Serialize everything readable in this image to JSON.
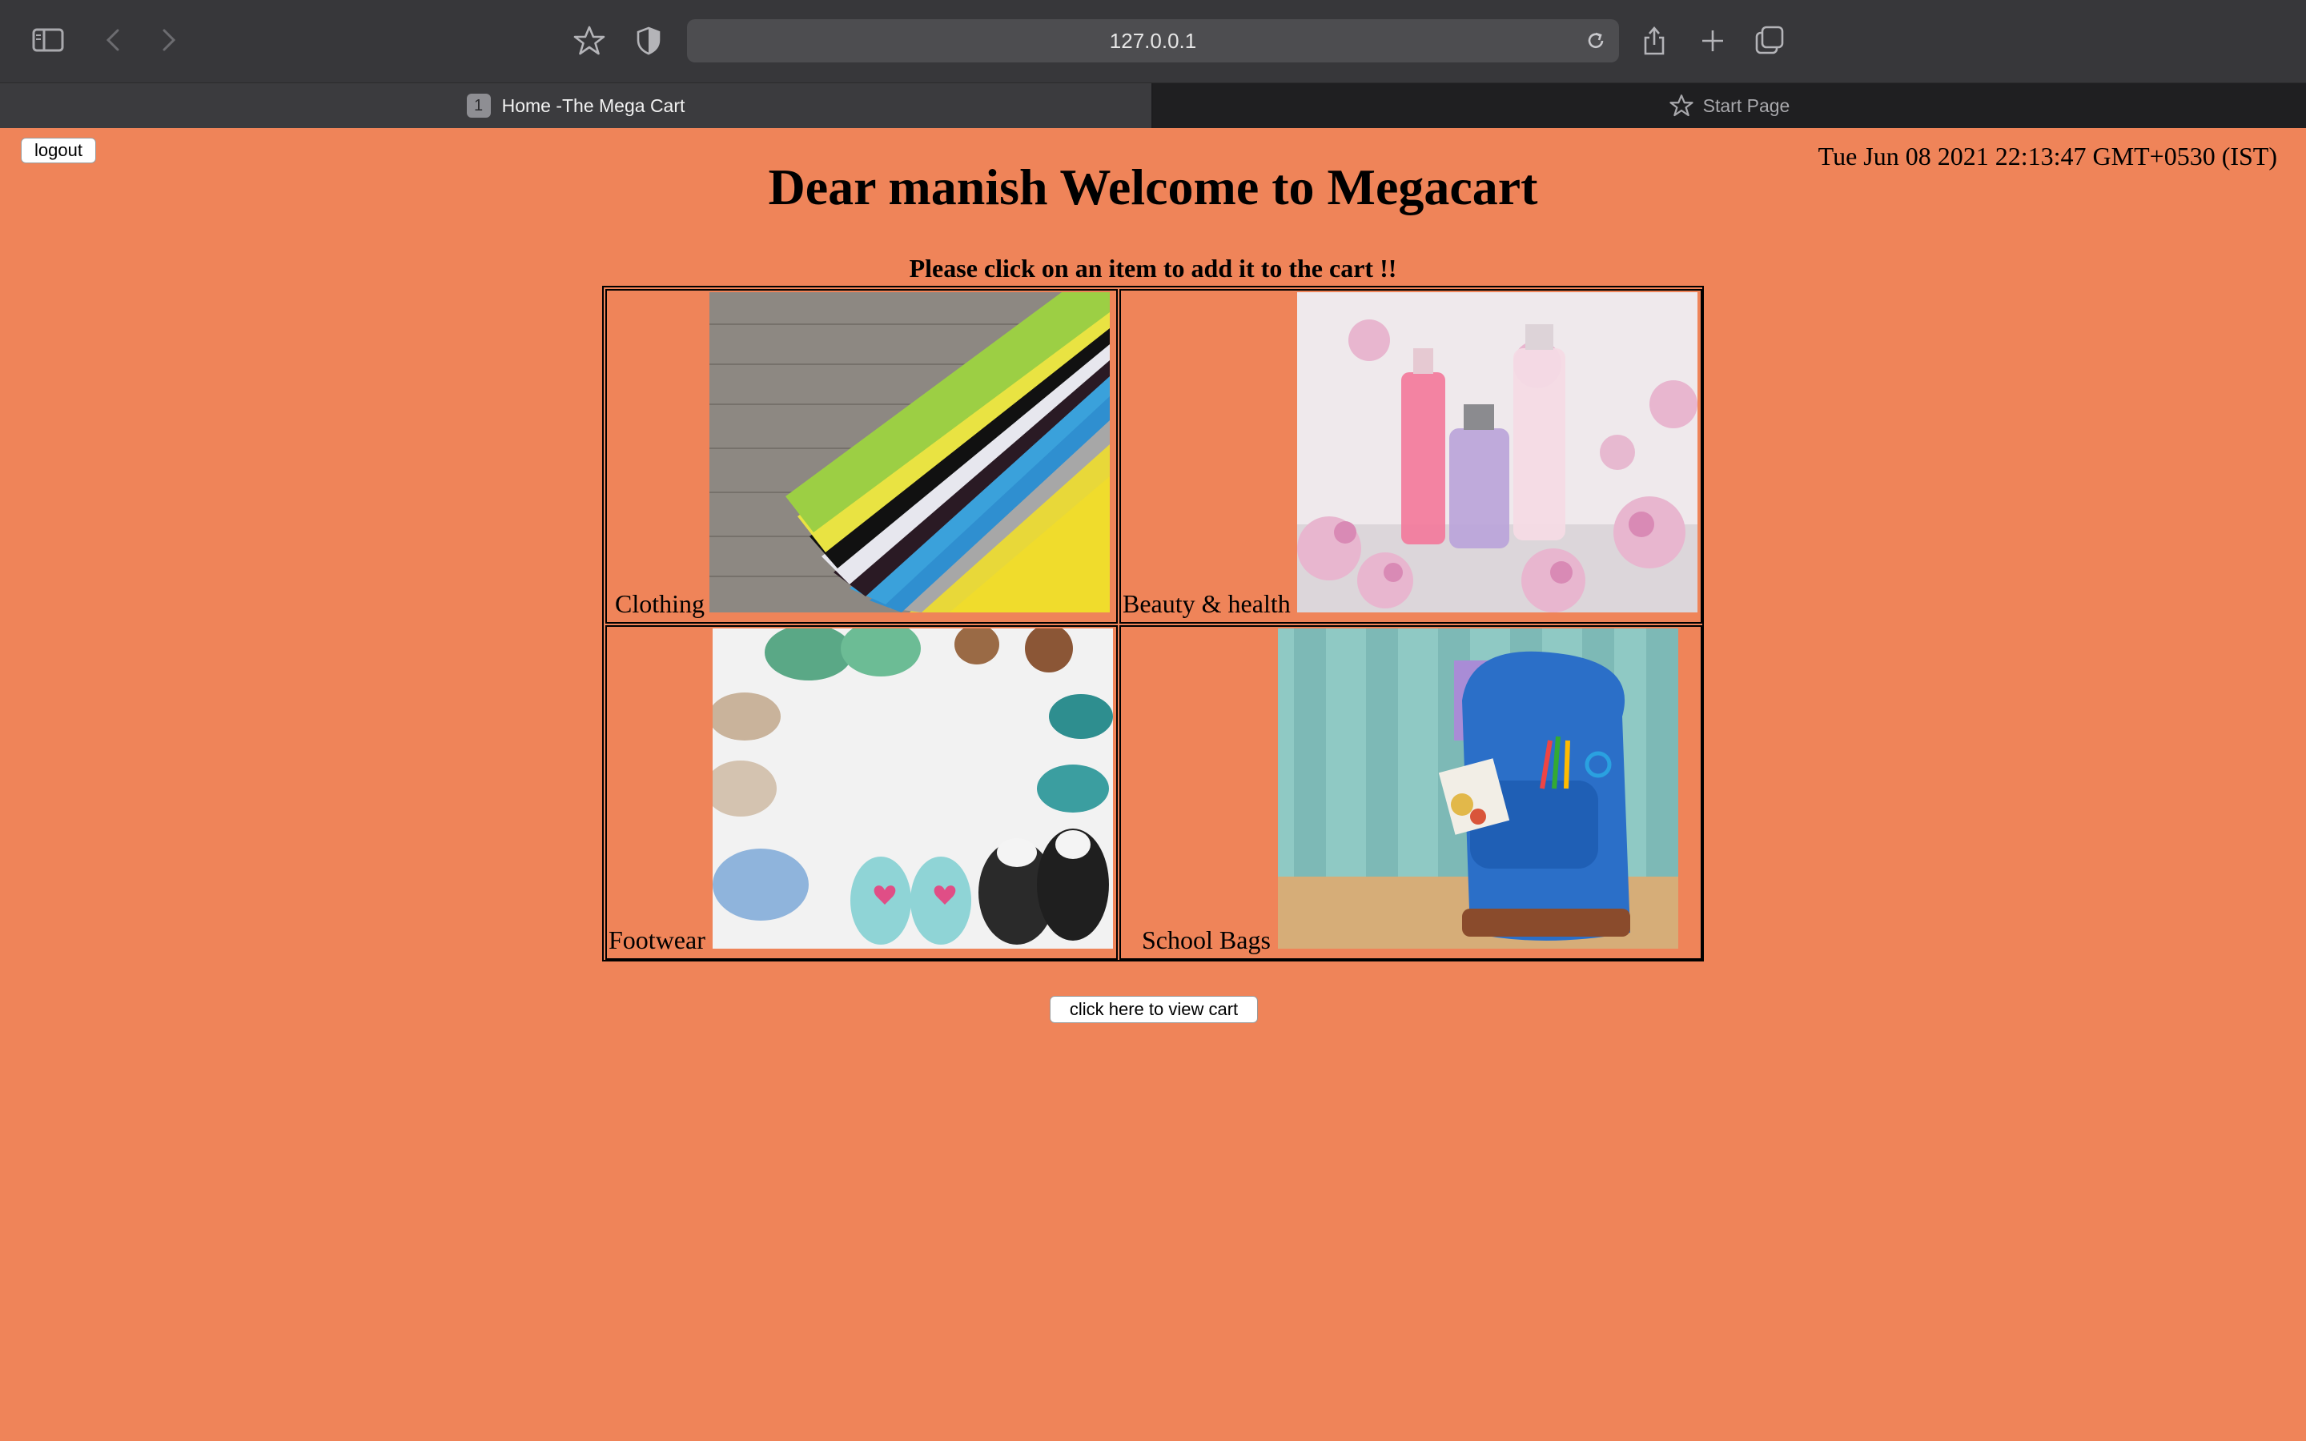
{
  "browser": {
    "url": "127.0.0.1",
    "tabs": [
      {
        "number": "1",
        "label": "Home -The Mega Cart",
        "active": true
      },
      {
        "label": "Start Page",
        "active": false
      }
    ],
    "icons": [
      "sidebar-icon",
      "back-icon",
      "forward-icon",
      "star-icon",
      "shield-icon",
      "reload-icon",
      "share-icon",
      "plus-icon",
      "tabs-overview-icon"
    ]
  },
  "page": {
    "background": "#ef8459",
    "logout_label": "logout",
    "datetime": "Tue Jun 08 2021 22:13:47 GMT+0530 (IST)",
    "heading": "Dear manish Welcome to Megacart",
    "prompt": "Please click on an item to add it to the cart !!",
    "categories": [
      {
        "label": "Clothing",
        "image": "clothing-image"
      },
      {
        "label": "Beauty & health",
        "image": "beauty-image"
      },
      {
        "label": "Footwear",
        "image": "footwear-image"
      },
      {
        "label": "School Bags",
        "image": "school-bag-image"
      }
    ],
    "view_cart_label": "click here to view cart"
  }
}
